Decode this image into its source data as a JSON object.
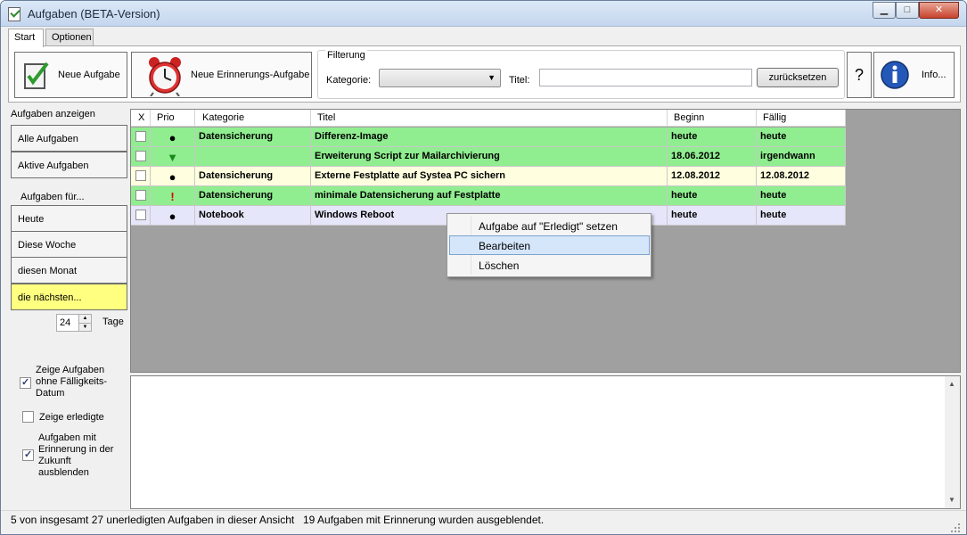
{
  "window": {
    "title": "Aufgaben (BETA-Version)",
    "min_icon": "minimize-icon",
    "max_icon": "maximize-icon",
    "close_icon": "close-icon",
    "min_glyph": "▁",
    "max_glyph": "□",
    "close_glyph": "✕"
  },
  "tabs": [
    {
      "label": "Start"
    },
    {
      "label": "Optionen"
    }
  ],
  "toolbar": {
    "new_task": "Neue Aufgabe",
    "new_reminder": "Neue Erinnerungs-Aufgabe",
    "filter": {
      "legend": "Filterung",
      "category_label": "Kategorie:",
      "category_value": "",
      "title_label": "Titel:",
      "title_value": "",
      "reset": "zurücksetzen"
    },
    "help": "?",
    "info": "Info..."
  },
  "sidebar": {
    "header": "Aufgaben anzeigen",
    "all": "Alle Aufgaben",
    "active": "Aktive Aufgaben",
    "for_header": "Aufgaben für...",
    "today": "Heute",
    "this_week": "Diese Woche",
    "this_month": "diesen Monat",
    "next": "die nächsten...",
    "days_value": "24",
    "days_label": "Tage",
    "opt_no_due": "Zeige Aufgaben ohne Fälligkeits-Datum",
    "opt_no_due_checked": true,
    "opt_done": "Zeige erledigte",
    "opt_done_checked": false,
    "opt_hide_future": "Aufgaben mit Erinnerung in der Zukunft ausblenden",
    "opt_hide_future_checked": true
  },
  "grid": {
    "columns": [
      "X",
      "Prio",
      "Kategorie",
      "Titel",
      "Beginn",
      "Fällig"
    ],
    "rows": [
      {
        "prio": "●",
        "prio_icon": "dot-icon",
        "prio_color": "#000000",
        "category": "Datensicherung",
        "title": "Differenz-Image",
        "begin": "heute",
        "due": "heute",
        "bg": "#90ee90"
      },
      {
        "prio": "▼",
        "prio_icon": "low-priority-arrow-icon",
        "prio_color": "#1a8a1a",
        "category": "",
        "title": "Erweiterung Script zur Mailarchivierung",
        "begin": "18.06.2012",
        "due": "irgendwann",
        "bg": "#90ee90"
      },
      {
        "prio": "●",
        "prio_icon": "dot-icon",
        "prio_color": "#000000",
        "category": "Datensicherung",
        "title": "Externe Festplatte auf Systea PC sichern",
        "begin": "12.08.2012",
        "due": "12.08.2012",
        "bg": "#ffffe0"
      },
      {
        "prio": "!",
        "prio_icon": "high-priority-icon",
        "prio_color": "#e00000",
        "category": "Datensicherung",
        "title": "minimale Datensicherung auf Festplatte",
        "begin": "heute",
        "due": "heute",
        "bg": "#90ee90"
      },
      {
        "prio": "●",
        "prio_icon": "dot-icon",
        "prio_color": "#000000",
        "category": "Notebook",
        "title": "Windows Reboot",
        "begin": "heute",
        "due": "heute",
        "bg": "#e6e6fa"
      }
    ]
  },
  "context_menu": {
    "items": [
      "Aufgabe auf \"Erledigt\" setzen",
      "Bearbeiten",
      "Löschen"
    ],
    "selected_index": 1
  },
  "status": {
    "left": "5 von insgesamt 27 unerledigten Aufgaben in dieser Ansicht",
    "right": "19 Aufgaben mit Erinnerung wurden ausgeblendet."
  }
}
